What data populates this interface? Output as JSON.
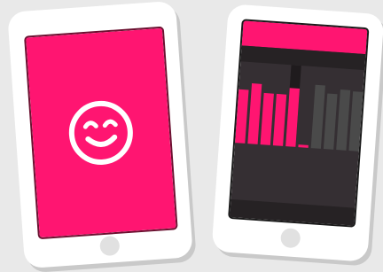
{
  "colors": {
    "background": "#e9e9e9",
    "phone_body": "#ffffff",
    "phone_shadow": "#c9c9c9",
    "home_button": "#e1e1e1",
    "accent": "#ff1571",
    "screen_dark": "#352f33",
    "screen_bezel_dark": "#262224",
    "bar_highlight": "#ff1571",
    "bar_muted": "#4a4a4a"
  },
  "left_phone": {
    "screen_color": "#ff1571",
    "icon": "smiley-face-icon"
  },
  "right_phone": {
    "header_color": "#ff1571",
    "bar_levels": [
      0.55,
      0.62,
      0.53,
      0.53,
      0.6,
      0.02,
      0.65,
      0.57,
      0.62,
      0.61
    ],
    "bar_highlighted": [
      true,
      true,
      true,
      true,
      true,
      true,
      false,
      false,
      false,
      false
    ],
    "peak_marker_index": 5
  }
}
